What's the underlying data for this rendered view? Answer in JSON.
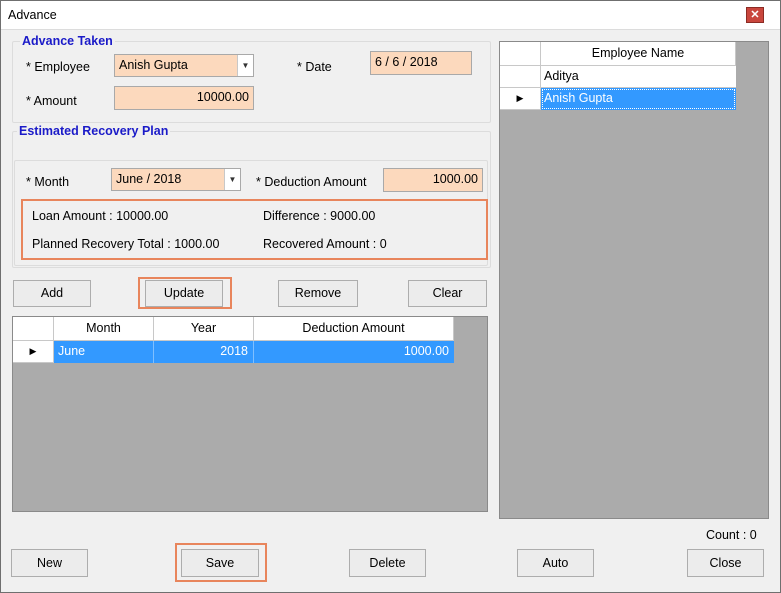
{
  "window": {
    "title": "Advance",
    "close_glyph": "✕"
  },
  "advance_taken": {
    "title": "Advance Taken",
    "employee_label": "* Employee",
    "employee_value": "Anish Gupta",
    "date_label": "* Date",
    "date_value": "6 / 6 / 2018",
    "amount_label": "* Amount",
    "amount_value": "10000.00"
  },
  "recovery_plan": {
    "title": "Estimated Recovery Plan",
    "month_label": "* Month",
    "month_value": "June / 2018",
    "deduction_label": "* Deduction Amount",
    "deduction_value": "1000.00",
    "loan_amount": "Loan Amount : 10000.00",
    "difference": "Difference : 9000.00",
    "planned_total": "Planned Recovery Total : 1000.00",
    "recovered_amount": "Recovered Amount : 0"
  },
  "plan_buttons": {
    "add": "Add",
    "update": "Update",
    "remove": "Remove",
    "clear": "Clear"
  },
  "plan_grid": {
    "columns": [
      "Month",
      "Year",
      "Deduction Amount"
    ],
    "rows": [
      {
        "month": "June",
        "year": "2018",
        "amount": "1000.00"
      }
    ]
  },
  "employee_grid": {
    "column": "Employee Name",
    "rows": [
      "Aditya",
      "Anish Gupta"
    ],
    "selected_index": 1
  },
  "count_text": "Count : 0",
  "footer_buttons": {
    "new": "New",
    "save": "Save",
    "delete": "Delete",
    "auto": "Auto",
    "close": "Close"
  },
  "colors": {
    "accent_highlight": "#e8855c",
    "input_fill": "#fcd9bd",
    "selection": "#3399ff",
    "section_title": "#1a1ac8"
  }
}
